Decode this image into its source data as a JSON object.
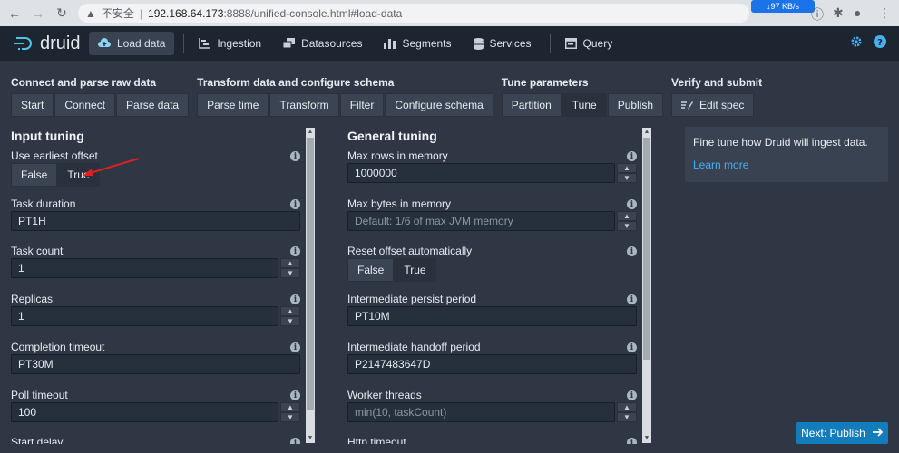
{
  "browser": {
    "insecure_label": "不安全",
    "url_host": "192.168.64.173",
    "url_path": ":8888/unified-console.html#load-data",
    "net_badge": "↓97 KB/s"
  },
  "header": {
    "logo_text": "druid",
    "nav": [
      {
        "label": "Load data",
        "icon": "cloud-upload-icon",
        "active": true
      },
      {
        "label": "Ingestion",
        "icon": "gantt-chart-icon"
      },
      {
        "label": "Datasources",
        "icon": "multi-select-icon"
      },
      {
        "label": "Segments",
        "icon": "stacked-chart-icon"
      },
      {
        "label": "Services",
        "icon": "database-icon"
      },
      {
        "label": "Query",
        "icon": "application-icon"
      }
    ]
  },
  "steps": [
    {
      "title": "Connect and parse raw data",
      "buttons": [
        "Start",
        "Connect",
        "Parse data"
      ]
    },
    {
      "title": "Transform data and configure schema",
      "buttons": [
        "Parse time",
        "Transform",
        "Filter",
        "Configure schema"
      ]
    },
    {
      "title": "Tune parameters",
      "buttons": [
        "Partition",
        "Tune",
        "Publish"
      ],
      "active": "Tune"
    },
    {
      "title": "Verify and submit",
      "buttons": [
        "Edit spec"
      ]
    }
  ],
  "input_tuning": {
    "title": "Input tuning",
    "fields": [
      {
        "label": "Use earliest offset",
        "type": "toggle",
        "options": [
          "False",
          "True"
        ],
        "selected": "True"
      },
      {
        "label": "Task duration",
        "type": "text",
        "value": "PT1H"
      },
      {
        "label": "Task count",
        "type": "number",
        "value": "1"
      },
      {
        "label": "Replicas",
        "type": "number",
        "value": "1"
      },
      {
        "label": "Completion timeout",
        "type": "text",
        "value": "PT30M"
      },
      {
        "label": "Poll timeout",
        "type": "number",
        "value": "100"
      },
      {
        "label": "Start delay",
        "type": "text",
        "value": ""
      }
    ]
  },
  "general_tuning": {
    "title": "General tuning",
    "fields": [
      {
        "label": "Max rows in memory",
        "type": "number",
        "value": "1000000"
      },
      {
        "label": "Max bytes in memory",
        "type": "number",
        "placeholder": "Default: 1/6 of max JVM memory"
      },
      {
        "label": "Reset offset automatically",
        "type": "toggle",
        "options": [
          "False",
          "True"
        ],
        "selected": "True"
      },
      {
        "label": "Intermediate persist period",
        "type": "text",
        "value": "PT10M"
      },
      {
        "label": "Intermediate handoff period",
        "type": "text",
        "value": "P2147483647D"
      },
      {
        "label": "Worker threads",
        "type": "number",
        "placeholder": "min(10, taskCount)"
      },
      {
        "label": "Http timeout",
        "type": "text",
        "value": ""
      }
    ]
  },
  "help": {
    "text": "Fine tune how Druid will ingest data.",
    "link": "Learn more"
  },
  "next_button": "Next: Publish",
  "colors": {
    "accent": "#137cbd",
    "link": "#48aff0",
    "annotation": "#e02020"
  }
}
